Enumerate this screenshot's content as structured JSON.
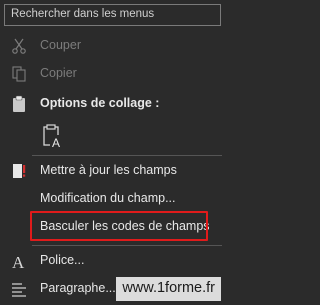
{
  "search": {
    "placeholder": "Rechercher dans les menus"
  },
  "items": {
    "cut": {
      "label": "Couper"
    },
    "copy": {
      "label": "Copier"
    },
    "paste_options": {
      "label": "Options de collage :"
    },
    "update_fields": {
      "label": "Mettre à jour les champs"
    },
    "edit_field": {
      "label": "Modification du champ..."
    },
    "toggle_codes": {
      "label": "Basculer les codes de champs"
    },
    "font": {
      "label": "Police..."
    },
    "paragraph": {
      "label": "Paragraphe..."
    }
  },
  "watermark": {
    "text": "www.1forme.fr"
  },
  "colors": {
    "background": "#2b2b2b",
    "highlight": "#e01b1b",
    "text": "#e8e8e8",
    "disabled": "#7c7c7c"
  }
}
